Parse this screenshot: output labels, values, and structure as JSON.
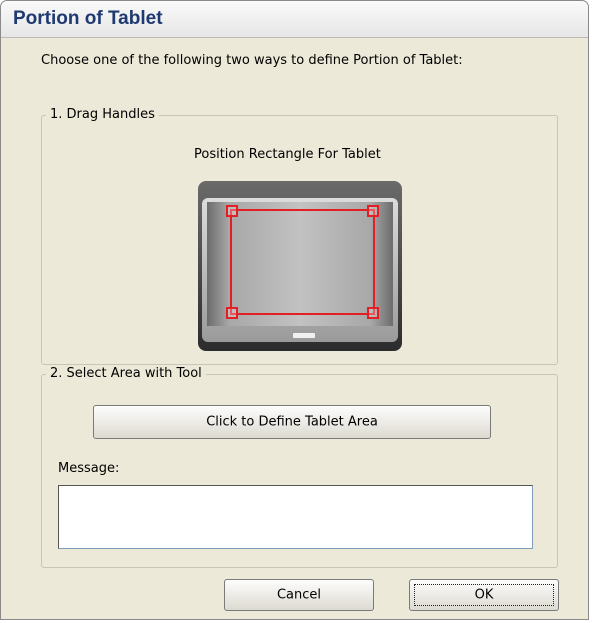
{
  "dialog": {
    "title": "Portion of Tablet",
    "intro": "Choose one of the following two ways to define Portion of Tablet:"
  },
  "drag_handles_group": {
    "label": "1. Drag Handles",
    "subtitle": "Position Rectangle For Tablet"
  },
  "select_area_group": {
    "label": "2. Select Area with Tool",
    "define_button": "Click to Define Tablet Area",
    "message_label": "Message:",
    "message_value": ""
  },
  "footer": {
    "cancel_button": "Cancel",
    "ok_button": "OK"
  },
  "colors": {
    "selection_rectangle": "#e31e24",
    "title_text": "#1f3a70"
  }
}
